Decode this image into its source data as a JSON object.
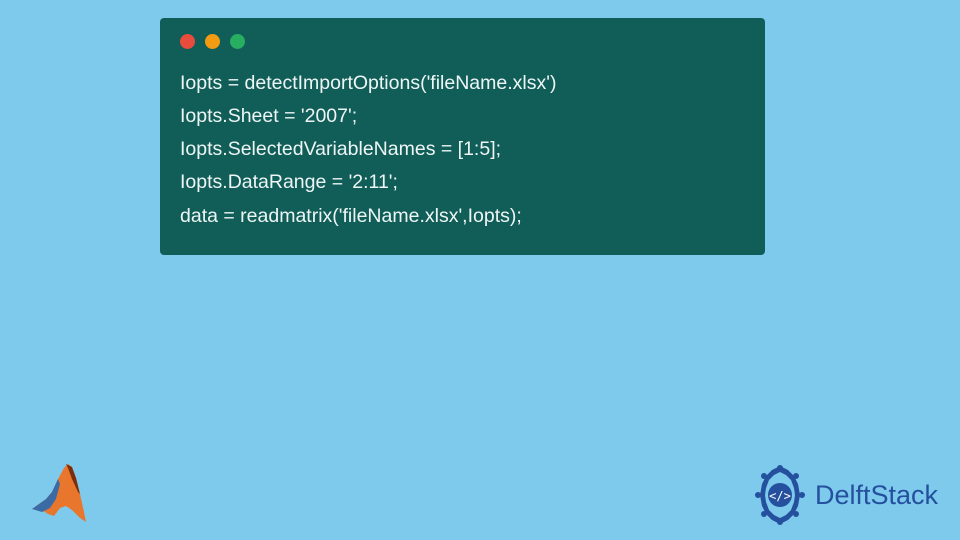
{
  "code": {
    "lines": [
      "Iopts = detectImportOptions('fileName.xlsx')",
      "Iopts.Sheet = '2007';",
      "Iopts.SelectedVariableNames = [1:5];",
      "Iopts.DataRange = '2:11';",
      "data = readmatrix('fileName.xlsx',Iopts);"
    ]
  },
  "branding": {
    "delftstack_label": "DelftStack"
  }
}
